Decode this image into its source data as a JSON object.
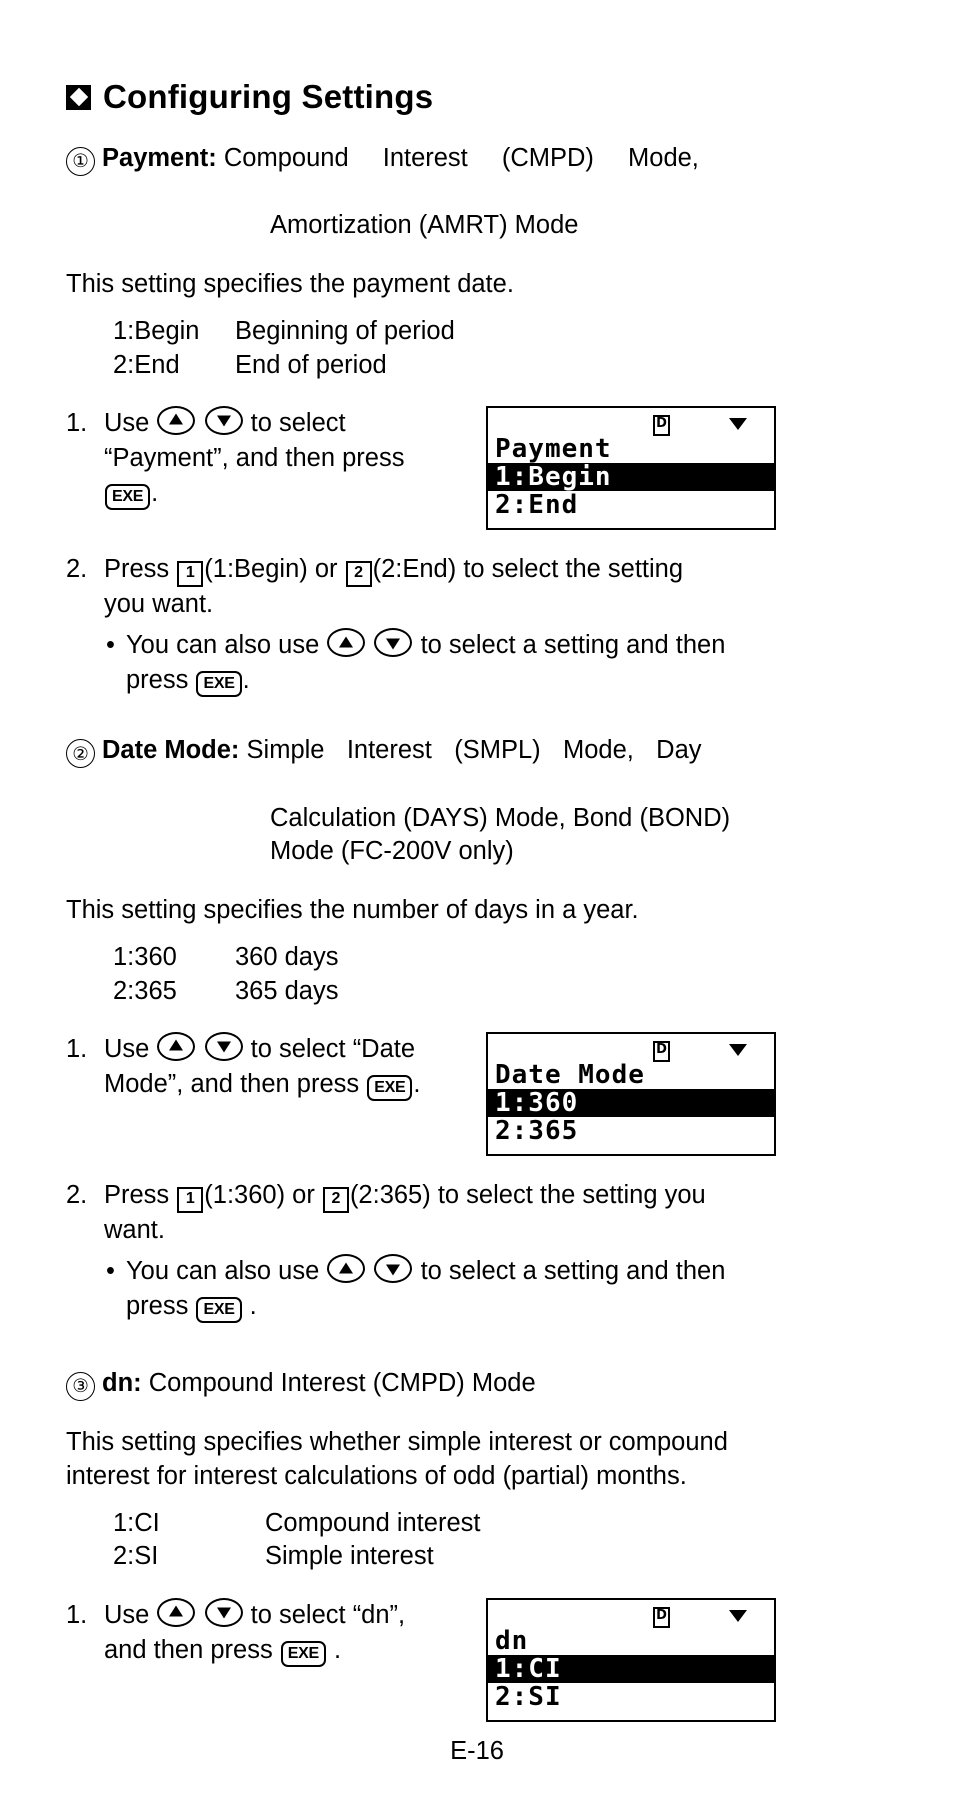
{
  "page": {
    "heading": "Configuring Settings",
    "footer": "E-16"
  },
  "sections": [
    {
      "number": "①",
      "label": "Payment:",
      "desc_line1": "Compound Interest (CMPD) Mode,",
      "desc_line2": "Amortization (AMRT) Mode",
      "intro": "This setting specifies the payment date.",
      "options": [
        {
          "key": "1:Begin",
          "value": "Beginning of period"
        },
        {
          "key": "2:End",
          "value": "End of period"
        }
      ],
      "step1": {
        "num": "1.",
        "text_a": "Use",
        "text_b": "to select",
        "text_c": "“Payment”, and then press",
        "key_exe": "EXE",
        "text_d": "."
      },
      "step2": {
        "num": "2.",
        "text_a": "Press",
        "key1": "1",
        "text_b": "(1:Begin) or",
        "key2": "2",
        "text_c": "(2:End) to select the setting",
        "text_d": "you want."
      },
      "bullet": {
        "dot": "•",
        "text_a": "You can also use",
        "text_b": "to select a setting and then",
        "text_c": "press",
        "key_exe": "EXE",
        "text_d": "."
      },
      "lcd": {
        "indicator_d": "D",
        "indicator_arrow": "▼",
        "line1": "Payment",
        "line2": "1:Begin",
        "line2_selected": true,
        "line3": "2:End"
      }
    },
    {
      "number": "②",
      "label": "Date Mode:",
      "desc_line1": "Simple Interest (SMPL) Mode, Day",
      "desc_line2": "Calculation (DAYS) Mode, Bond (BOND)",
      "desc_line3": "Mode (FC-200V only)",
      "intro": "This setting specifies the number of days in a year.",
      "options": [
        {
          "key": "1:360",
          "value": "360 days"
        },
        {
          "key": "2:365",
          "value": "365 days"
        }
      ],
      "step1": {
        "num": "1.",
        "text_a": "Use",
        "text_b": "to select “Date",
        "text_c": "Mode”, and then press",
        "key_exe": "EXE",
        "text_d": "."
      },
      "step2": {
        "num": "2.",
        "text_a": "Press",
        "key1": "1",
        "text_b": "(1:360) or",
        "key2": "2",
        "text_c": "(2:365) to select the setting you",
        "text_d": "want."
      },
      "bullet": {
        "dot": "•",
        "text_a": "You can also use",
        "text_b": "to select a setting and then",
        "text_c": "press",
        "key_exe": "EXE",
        "text_d": "."
      },
      "lcd": {
        "indicator_d": "D",
        "indicator_arrow": "▼",
        "line1": "Date Mode",
        "line2": "1:360",
        "line2_selected": true,
        "line3": "2:365"
      }
    },
    {
      "number": "③",
      "label": "dn:",
      "desc_line1": "Compound Interest (CMPD) Mode",
      "intro_line1": "This setting specifies whether simple interest or compound",
      "intro_line2": "interest for interest calculations of odd (partial) months.",
      "options": [
        {
          "key": "1:CI",
          "value": "Compound interest"
        },
        {
          "key": "2:SI",
          "value": "Simple interest"
        }
      ],
      "step1": {
        "num": "1.",
        "text_a": "Use",
        "text_b": "to select “dn”,",
        "text_c": "and then press",
        "key_exe": "EXE",
        "text_d": "."
      },
      "lcd": {
        "indicator_d": "D",
        "indicator_arrow": "▼",
        "line1": "dn",
        "line2": "1:CI",
        "line2_selected": true,
        "line3": "2:SI"
      }
    }
  ],
  "icons": {
    "diamond": "diamond-bullet",
    "up_key": "arrow-up-key",
    "down_key": "arrow-down-key"
  }
}
